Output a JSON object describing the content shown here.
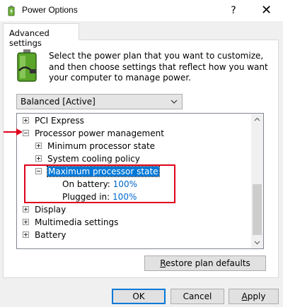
{
  "window": {
    "title": "Power Options",
    "help_label": "?",
    "close_label": "✕"
  },
  "tab": {
    "label": "Advanced settings"
  },
  "description": "Select the power plan that you want to customize, and then choose settings that reflect how you want your computer to manage power.",
  "plan_dropdown": {
    "selected": "Balanced [Active]"
  },
  "tree": {
    "pci_express": "PCI Express",
    "processor_power_management": "Processor power management",
    "minimum_processor_state": "Minimum processor state",
    "system_cooling_policy": "System cooling policy",
    "maximum_processor_state": "Maximum processor state",
    "on_battery_label": "On battery:",
    "on_battery_value": "100%",
    "plugged_in_label": "Plugged in:",
    "plugged_in_value": "100%",
    "display": "Display",
    "multimedia_settings": "Multimedia settings",
    "battery": "Battery"
  },
  "buttons": {
    "restore_first": "R",
    "restore_rest": "estore plan defaults",
    "ok": "OK",
    "cancel": "Cancel",
    "apply_first": "A",
    "apply_rest": "pply"
  },
  "colors": {
    "selection": "#0078d7",
    "value_link": "#0066cc",
    "annotation": "#e0001b"
  }
}
